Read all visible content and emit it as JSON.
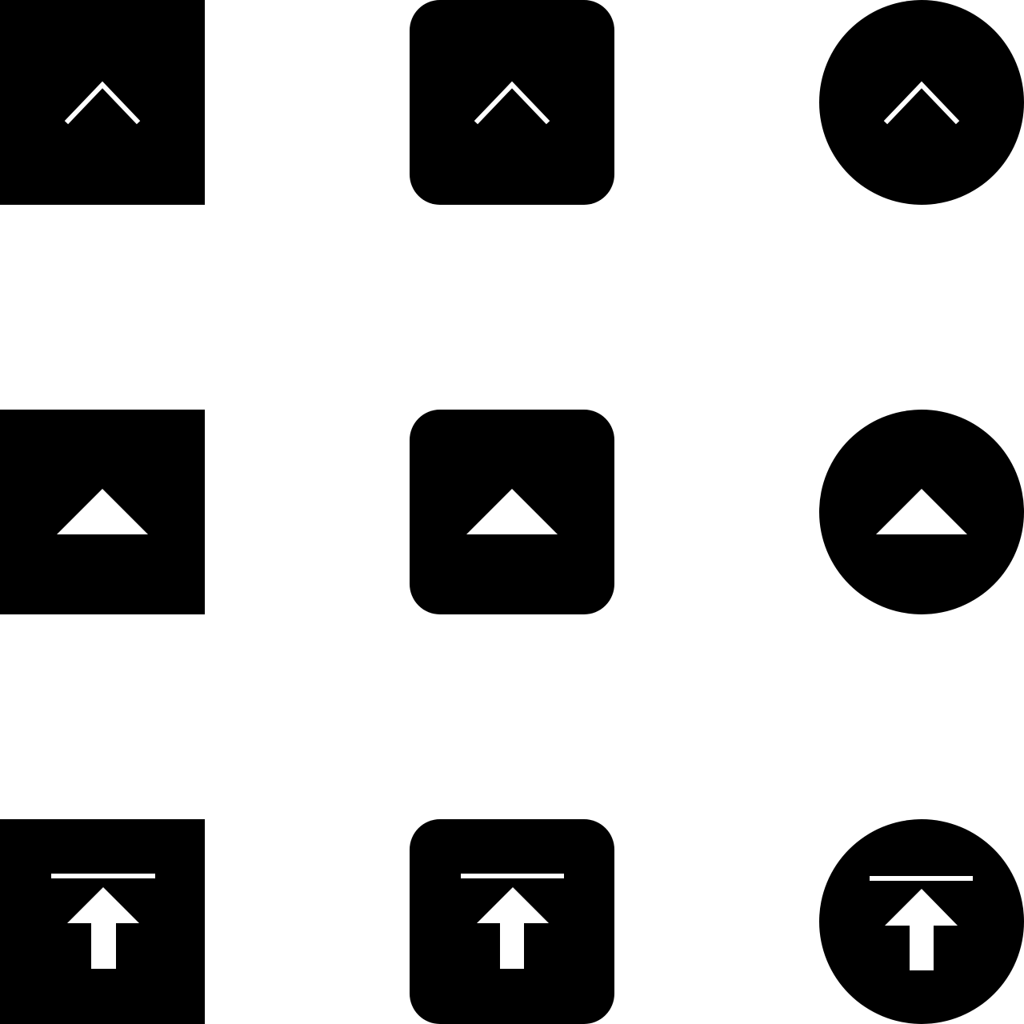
{
  "colors": {
    "background": "#ffffff",
    "tile": "#000000",
    "glyph": "#ffffff"
  },
  "icon_grid": {
    "rows": [
      {
        "glyph": "chevron-up-icon",
        "shapes": [
          "square",
          "rounded",
          "circle"
        ]
      },
      {
        "glyph": "triangle-up-icon",
        "shapes": [
          "square",
          "rounded",
          "circle"
        ]
      },
      {
        "glyph": "arrow-up-to-line-icon",
        "shapes": [
          "square",
          "rounded",
          "circle"
        ]
      }
    ]
  }
}
